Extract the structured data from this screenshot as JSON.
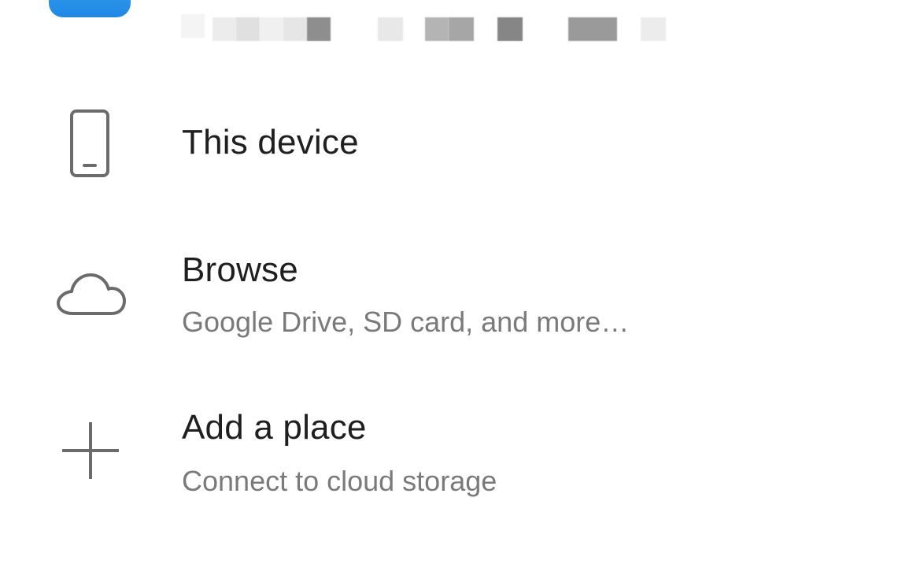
{
  "account": {
    "logo_color": "#1e88e5",
    "name_blurred": "",
    "logo_icon": "onedrive-cloud-icon"
  },
  "places": [
    {
      "icon": "phone-icon",
      "title": "This device",
      "subtitle": ""
    },
    {
      "icon": "cloud-icon",
      "title": "Browse",
      "subtitle": "Google Drive, SD card, and more…"
    },
    {
      "icon": "plus-icon",
      "title": "Add a place",
      "subtitle": "Connect to cloud storage"
    }
  ],
  "colors": {
    "title": "#1f1f1f",
    "subtitle": "#7a7a7a",
    "icon": "#6b6b6b",
    "background": "#ffffff"
  }
}
